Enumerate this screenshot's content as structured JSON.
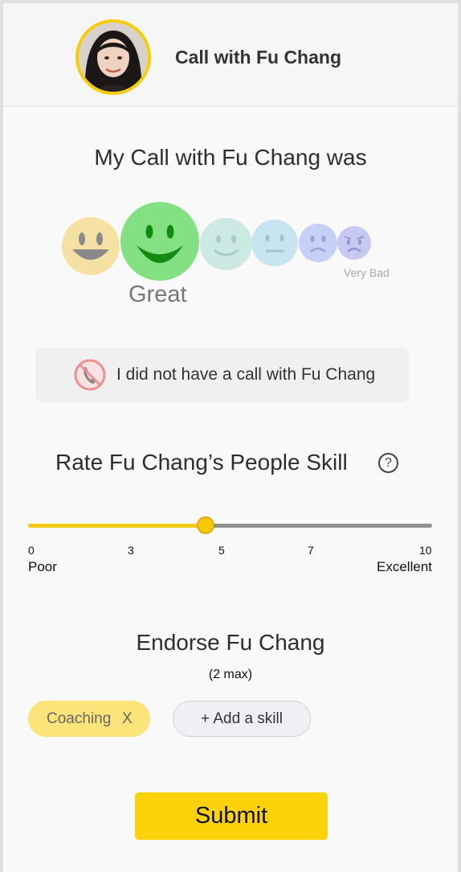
{
  "header": {
    "title": "Call with Fu Chang",
    "avatar_alt": "Fu Chang"
  },
  "call_rating": {
    "question": "My Call with Fu Chang was",
    "selected_label": "Great",
    "low_label": "Very Bad",
    "faces": [
      {
        "name": "very-happy",
        "color": "#f5e1a3"
      },
      {
        "name": "great",
        "color": "#83e183",
        "selected": true
      },
      {
        "name": "good",
        "color": "#cce9e4"
      },
      {
        "name": "neutral",
        "color": "#c7e4f0"
      },
      {
        "name": "bad",
        "color": "#c8cff7"
      },
      {
        "name": "very-bad",
        "color": "#c7c9f2"
      }
    ]
  },
  "no_call": {
    "label": "I did not have a call with Fu Chang",
    "icon": "no-phone-icon"
  },
  "people_skill": {
    "title": "Rate Fu Chang’s People Skill",
    "help_icon": "?",
    "value": 4.4,
    "min": 0,
    "max": 10,
    "ticks": [
      "0",
      "3",
      "5",
      "7",
      "10"
    ],
    "min_label": "Poor",
    "max_label": "Excellent",
    "fill_color": "#f2cb16"
  },
  "endorse": {
    "title": "Endorse Fu Chang",
    "subtitle": "(2 max)",
    "chips": [
      {
        "label": "Coaching",
        "remove": "X"
      }
    ],
    "add_label": "+ Add a skill"
  },
  "submit_label": "Submit",
  "colors": {
    "accent": "#fdd20a",
    "chip_bg": "#fde47a"
  }
}
